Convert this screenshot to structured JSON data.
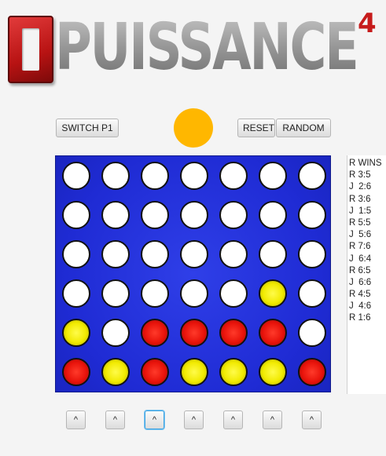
{
  "logo": {
    "text": "PUISSANCE",
    "superscript": "4"
  },
  "controls": {
    "switch_label": "SWITCH P1",
    "reset_label": "RESET",
    "random_label": "RANDOM",
    "current_token_color": "#ffb700"
  },
  "board": {
    "rows": 6,
    "cols": 7,
    "grid": [
      [
        "E",
        "E",
        "E",
        "E",
        "E",
        "E",
        "E"
      ],
      [
        "E",
        "E",
        "E",
        "E",
        "E",
        "E",
        "E"
      ],
      [
        "E",
        "E",
        "E",
        "E",
        "E",
        "E",
        "E"
      ],
      [
        "E",
        "E",
        "E",
        "E",
        "E",
        "Y",
        "E"
      ],
      [
        "Y",
        "E",
        "R",
        "R",
        "R",
        "R",
        "E"
      ],
      [
        "R",
        "Y",
        "R",
        "Y",
        "Y",
        "Y",
        "R"
      ]
    ],
    "colors": {
      "board": "#2230dc",
      "red": "#e8130b",
      "yellow": "#f1ea00",
      "empty": "#ffffff"
    }
  },
  "moves": [
    "R WINS",
    "R 3:5",
    "J  2:6",
    "R 3:6",
    "J  1:5",
    "R 5:5",
    "J  5:6",
    "R 7:6",
    "J  6:4",
    "R 6:5",
    "J  6:6",
    "R 4:5",
    "J  4:6",
    "R 1:6"
  ],
  "drop_buttons": [
    "^",
    "^",
    "^",
    "^",
    "^",
    "^",
    "^"
  ]
}
